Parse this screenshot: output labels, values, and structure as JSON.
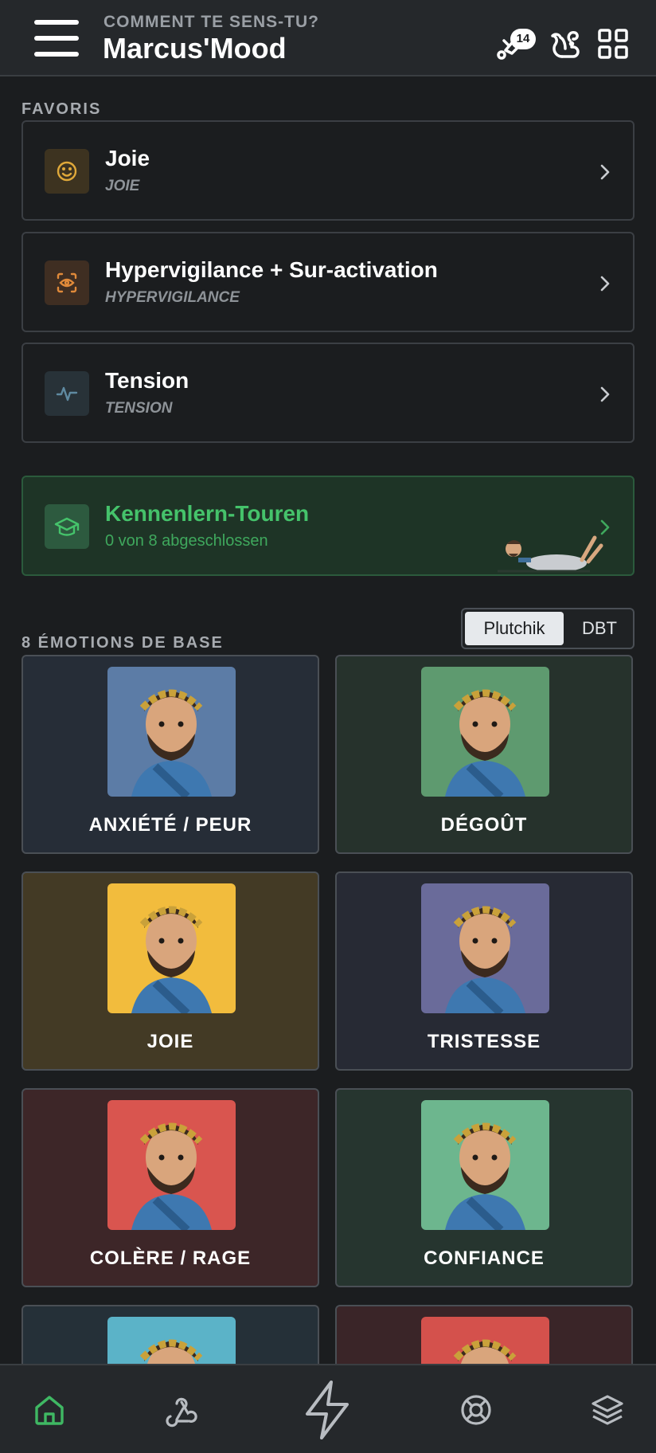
{
  "header": {
    "subtitle": "COMMENT TE SENS-TU?",
    "title": "Marcus'Mood",
    "notification_count": "14",
    "icons": [
      "menu-icon",
      "notification-icon",
      "squirrel-icon",
      "grid-icon"
    ]
  },
  "favorites": {
    "label": "FAVORIS",
    "items": [
      {
        "title": "Joie",
        "subtitle": "JOIE",
        "icon": "smile-icon",
        "color": "#e0a93a"
      },
      {
        "title": "Hypervigilance + Sur-activation",
        "subtitle": "HYPERVIGILANCE",
        "icon": "scan-eye-icon",
        "color": "#e08a3a"
      },
      {
        "title": "Tension",
        "subtitle": "TENSION",
        "icon": "pulse-icon",
        "color": "#5f8aa1"
      }
    ]
  },
  "tour": {
    "title": "Kennenlern-Touren",
    "subtitle": "0 von 8 abgeschlossen",
    "icon": "graduation-cap-icon"
  },
  "emotions": {
    "label": "8 ÉMOTIONS DE BASE",
    "toggle": {
      "options": [
        "Plutchik",
        "DBT"
      ],
      "selected": "Plutchik"
    },
    "items": [
      {
        "label": "ANXIÉTÉ / PEUR",
        "card_bg": "#262d37",
        "pic_bg": "#5c7ca6"
      },
      {
        "label": "DÉGOÛT",
        "card_bg": "#26322c",
        "pic_bg": "#5e9a6f"
      },
      {
        "label": "JOIE",
        "card_bg": "#433a25",
        "pic_bg": "#f2bc3d"
      },
      {
        "label": "TRISTESSE",
        "card_bg": "#272a34",
        "pic_bg": "#6a6b9a"
      },
      {
        "label": "COLÈRE / RAGE",
        "card_bg": "#3d2628",
        "pic_bg": "#d9554f"
      },
      {
        "label": "CONFIANCE",
        "card_bg": "#26352f",
        "pic_bg": "#6db68e"
      },
      {
        "label": "",
        "card_bg": "#253038",
        "pic_bg": "#5bb3c8"
      },
      {
        "label": "",
        "card_bg": "#3a2528",
        "pic_bg": "#d4514c"
      }
    ]
  },
  "bottom_nav": [
    "home-icon",
    "webhook-icon",
    "lightning-icon",
    "lifebuoy-icon",
    "layers-icon"
  ]
}
